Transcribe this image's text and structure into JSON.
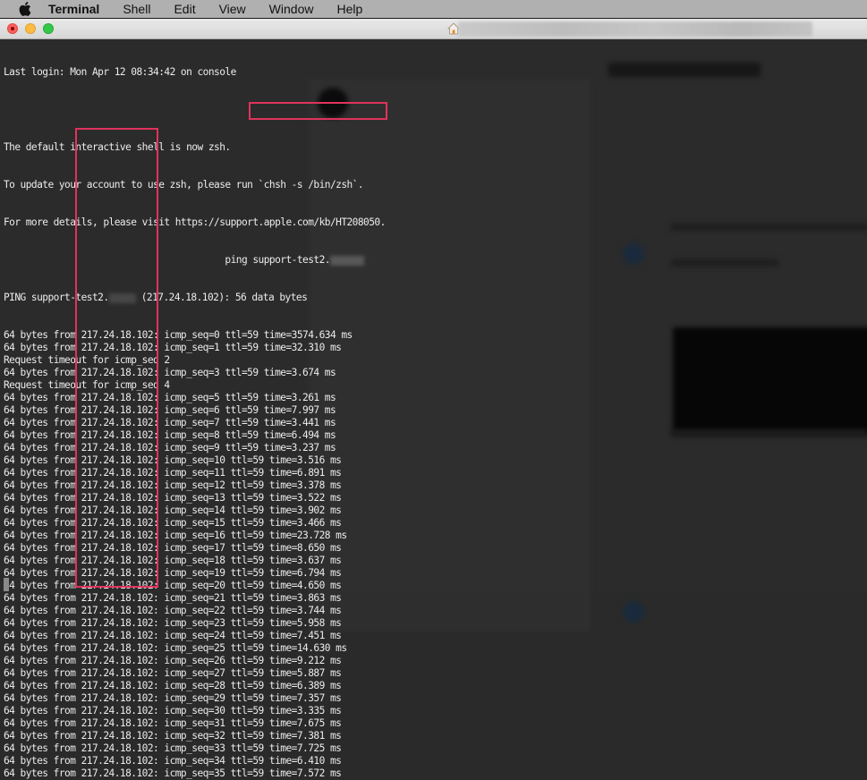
{
  "menubar": {
    "apple_icon": "apple-logo-icon",
    "app_name": "Terminal",
    "items": [
      "Shell",
      "Edit",
      "View",
      "Window",
      "Help"
    ]
  },
  "window": {
    "title_icon": "home-icon",
    "title": "[blurred]"
  },
  "terminal": {
    "intro": [
      "Last login: Mon Apr 12 08:34:42 on console",
      "",
      "The default interactive shell is now zsh.",
      "To update your account to use zsh, please run `chsh -s /bin/zsh`.",
      "For more details, please visit https://support.apple.com/kb/HT208050."
    ],
    "prompt_padding": "                                        ",
    "command": "ping support-test2.",
    "ping_header_prefix": "PING support-test2.",
    "ping_header_suffix": " (217.24.18.102): 56 data bytes",
    "ip": "217.24.18.102",
    "lines": [
      {
        "type": "reply",
        "seq": 0,
        "ttl": 59,
        "time": "3574.634"
      },
      {
        "type": "reply",
        "seq": 1,
        "ttl": 59,
        "time": "32.310"
      },
      {
        "type": "timeout",
        "seq": 2
      },
      {
        "type": "reply",
        "seq": 3,
        "ttl": 59,
        "time": "3.674"
      },
      {
        "type": "timeout",
        "seq": 4
      },
      {
        "type": "reply",
        "seq": 5,
        "ttl": 59,
        "time": "3.261"
      },
      {
        "type": "reply",
        "seq": 6,
        "ttl": 59,
        "time": "7.997"
      },
      {
        "type": "reply",
        "seq": 7,
        "ttl": 59,
        "time": "3.441"
      },
      {
        "type": "reply",
        "seq": 8,
        "ttl": 59,
        "time": "6.494"
      },
      {
        "type": "reply",
        "seq": 9,
        "ttl": 59,
        "time": "3.237"
      },
      {
        "type": "reply",
        "seq": 10,
        "ttl": 59,
        "time": "3.516"
      },
      {
        "type": "reply",
        "seq": 11,
        "ttl": 59,
        "time": "6.891"
      },
      {
        "type": "reply",
        "seq": 12,
        "ttl": 59,
        "time": "3.378"
      },
      {
        "type": "reply",
        "seq": 13,
        "ttl": 59,
        "time": "3.522"
      },
      {
        "type": "reply",
        "seq": 14,
        "ttl": 59,
        "time": "3.902"
      },
      {
        "type": "reply",
        "seq": 15,
        "ttl": 59,
        "time": "3.466"
      },
      {
        "type": "reply",
        "seq": 16,
        "ttl": 59,
        "time": "23.728"
      },
      {
        "type": "reply",
        "seq": 17,
        "ttl": 59,
        "time": "8.650"
      },
      {
        "type": "reply",
        "seq": 18,
        "ttl": 59,
        "time": "3.637"
      },
      {
        "type": "reply",
        "seq": 19,
        "ttl": 59,
        "time": "6.794"
      },
      {
        "type": "reply",
        "seq": 20,
        "ttl": 59,
        "time": "4.650"
      },
      {
        "type": "reply",
        "seq": 21,
        "ttl": 59,
        "time": "3.863"
      },
      {
        "type": "reply",
        "seq": 22,
        "ttl": 59,
        "time": "3.744"
      },
      {
        "type": "reply",
        "seq": 23,
        "ttl": 59,
        "time": "5.958"
      },
      {
        "type": "reply",
        "seq": 24,
        "ttl": 59,
        "time": "7.451"
      },
      {
        "type": "reply",
        "seq": 25,
        "ttl": 59,
        "time": "14.630"
      },
      {
        "type": "reply",
        "seq": 26,
        "ttl": 59,
        "time": "9.212"
      },
      {
        "type": "reply",
        "seq": 27,
        "ttl": 59,
        "time": "5.887"
      },
      {
        "type": "reply",
        "seq": 28,
        "ttl": 59,
        "time": "6.389"
      },
      {
        "type": "reply",
        "seq": 29,
        "ttl": 59,
        "time": "7.357"
      },
      {
        "type": "reply",
        "seq": 30,
        "ttl": 59,
        "time": "3.335"
      },
      {
        "type": "reply",
        "seq": 31,
        "ttl": 59,
        "time": "7.675"
      },
      {
        "type": "reply",
        "seq": 32,
        "ttl": 59,
        "time": "7.381"
      },
      {
        "type": "reply",
        "seq": 33,
        "ttl": 59,
        "time": "7.725"
      },
      {
        "type": "reply",
        "seq": 34,
        "ttl": 59,
        "time": "6.410"
      },
      {
        "type": "reply",
        "seq": 35,
        "ttl": 59,
        "time": "7.572"
      }
    ]
  },
  "annotations": {
    "color": "#e0335c"
  }
}
